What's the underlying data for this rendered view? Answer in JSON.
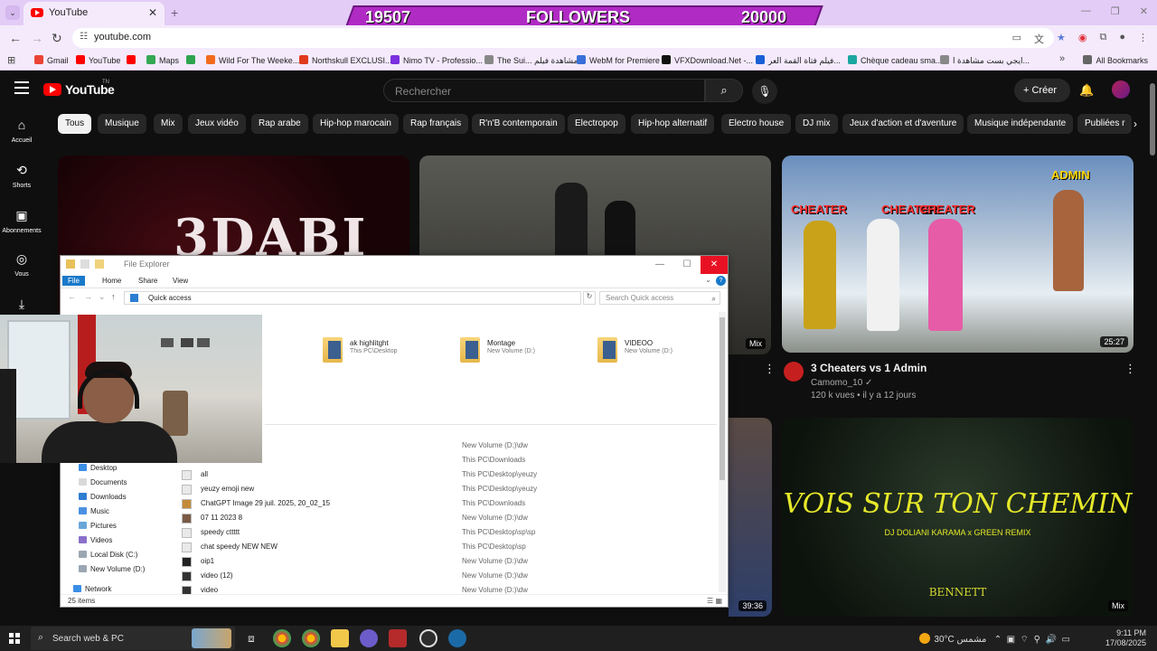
{
  "browser": {
    "tab_title": "YouTube",
    "url": "youtube.com",
    "bookmarks": [
      {
        "label": "Gmail",
        "color": "#ea4335"
      },
      {
        "label": "YouTube",
        "color": "#ff0000"
      },
      {
        "label": "",
        "color": "#ff0000"
      },
      {
        "label": "Maps",
        "color": "#34a853"
      },
      {
        "label": "",
        "color": "#2ea44f"
      },
      {
        "label": "Wild For The Weeke...",
        "color": "#f26b1d"
      },
      {
        "label": "Northskull EXCLUSI...",
        "color": "#e03a1e"
      },
      {
        "label": "Nimo TV - Professio...",
        "color": "#7b2fe0"
      },
      {
        "label": "The Sui... مشاهدة فيلم",
        "color": "#888888"
      },
      {
        "label": "WebM for Premiere",
        "color": "#3a6fd8"
      },
      {
        "label": "VFXDownload.Net -...",
        "color": "#111111"
      },
      {
        "label": "فيلم فتاة القمة العر...",
        "color": "#1a5fd6"
      },
      {
        "label": "Chèque cadeau sma...",
        "color": "#1aa7a1"
      },
      {
        "label": "ايجي بست مشاهدة ا...",
        "color": "#888888"
      }
    ],
    "all_bookmarks": "All Bookmarks"
  },
  "overlay": {
    "current": "19507",
    "label": "FOLLOWERS",
    "goal": "20000"
  },
  "youtube": {
    "wordmark": "YouTube",
    "country": "TN",
    "search_placeholder": "Rechercher",
    "create_label": "Créer",
    "guide": [
      {
        "label": "Accueil",
        "icon": "home-icon"
      },
      {
        "label": "Shorts",
        "icon": "shorts-icon"
      },
      {
        "label": "Abonnements",
        "icon": "subscriptions-icon"
      },
      {
        "label": "Vous",
        "icon": "you-icon"
      },
      {
        "label": "",
        "icon": "download-icon"
      }
    ],
    "chips": [
      "Tous",
      "Musique",
      "Mix",
      "Jeux vidéo",
      "Rap arabe",
      "Hip-hop marocain",
      "Rap français",
      "R'n'B contemporain",
      "Electropop",
      "Hip-hop alternatif",
      "Electro house",
      "DJ mix",
      "Jeux d'action et d'aventure",
      "Musique indépendante",
      "Publiées r"
    ],
    "videos": [
      {
        "thumb_text": "3DABI"
      },
      {
        "badge": "Mix"
      },
      {
        "duration": "25:27",
        "title": "3 Cheaters vs 1 Admin",
        "channel": "Camomo_10",
        "stats": "120 k vues • il y a 12 jours",
        "labels": [
          "CHEATER",
          "CHEATER",
          "CHEATER"
        ],
        "admin": "ADMIN"
      },
      {
        "duration": "39:36"
      },
      {
        "badge": "Mix",
        "title_art": "VOIS SUR TON CHEMIN",
        "subtitle_art": "DJ DOLIANI KARAMA x GREEN REMIX",
        "signature": "BENNETT"
      }
    ]
  },
  "explorer": {
    "title": "File Explorer",
    "ribbon_tabs": [
      "File",
      "Home",
      "Share",
      "View"
    ],
    "path": "Quick access",
    "search_placeholder": "Search Quick access",
    "folders": [
      {
        "name": "ak highlitght",
        "location": "This PC\\Desktop"
      },
      {
        "name": "Montage",
        "location": "New Volume (D:)"
      },
      {
        "name": "VIDEOO",
        "location": "New Volume (D:)"
      }
    ],
    "nav": [
      "Desktop",
      "Documents",
      "Downloads",
      "Music",
      "Pictures",
      "Videos",
      "Local Disk (C:)",
      "New Volume (D:)",
      "Network"
    ],
    "files": [
      {
        "name": "",
        "location": "New Volume (D:)\\dw"
      },
      {
        "name": "",
        "location": "This PC\\Downloads"
      },
      {
        "name": "",
        "location": "This PC\\Desktop\\yeuzy"
      },
      {
        "name": "all",
        "location": "This PC\\Desktop\\yeuzy"
      },
      {
        "name": "yeuzy emoji new",
        "location": "This PC\\Desktop\\yeuzy"
      },
      {
        "name": "ChatGPT Image 29 juil. 2025, 20_02_15",
        "location": "This PC\\Downloads"
      },
      {
        "name": "07 11 2023 8",
        "location": "New Volume (D:)\\dw"
      },
      {
        "name": "speedy cttttt",
        "location": "This PC\\Desktop\\sp\\sp"
      },
      {
        "name": "chat speedy NEW NEW",
        "location": "This PC\\Desktop\\sp"
      },
      {
        "name": "oip1",
        "location": "New Volume (D:)\\dw"
      },
      {
        "name": "video (12)",
        "location": "New Volume (D:)\\dw"
      },
      {
        "name": "video",
        "location": "New Volume (D:)\\dw"
      }
    ],
    "item_count": "25 items"
  },
  "taskbar": {
    "search_text": "Search web & PC",
    "weather": "30°C",
    "weather_desc": "مشمس",
    "time": "9:11 PM",
    "date": "17/08/2025"
  }
}
